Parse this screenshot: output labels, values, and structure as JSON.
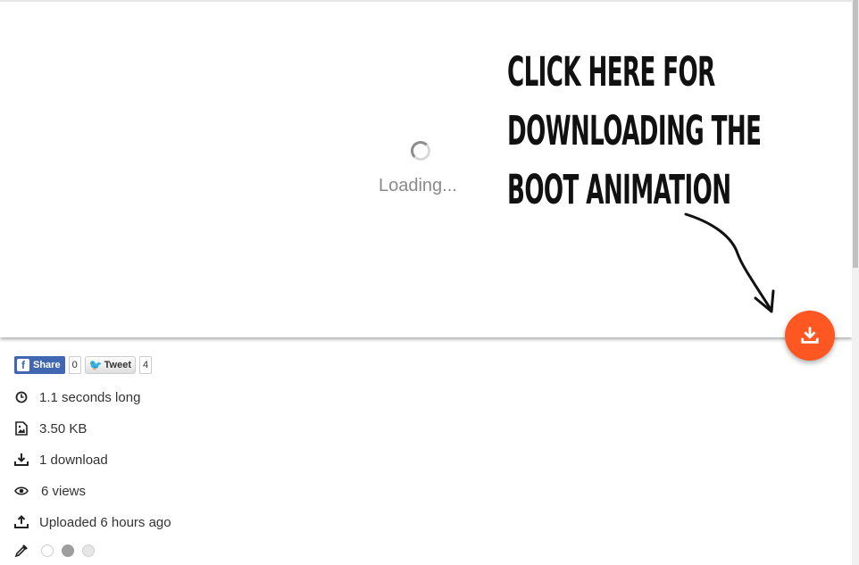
{
  "preview": {
    "loading_text": "Loading...",
    "annotation_lines": [
      "CLICK HERE FOR",
      "DOWNLOADING THE",
      "BOOT ANIMATION"
    ]
  },
  "download_fab": {
    "icon": "download-icon",
    "color": "#ff5722"
  },
  "social": {
    "share_label": "Share",
    "share_count": "0",
    "tweet_label": "Tweet",
    "tweet_count": "4",
    "facebook_color": "#4267b2"
  },
  "meta": {
    "duration": "1.1 seconds long",
    "size": "3.50 KB",
    "downloads": "1 download",
    "views": "6 views",
    "uploaded": "Uploaded 6 hours ago"
  },
  "colors": {
    "icon": "eyedropper-icon",
    "swatches": [
      "#ffffff",
      "#9e9e9e",
      "#e6e6e6"
    ]
  }
}
